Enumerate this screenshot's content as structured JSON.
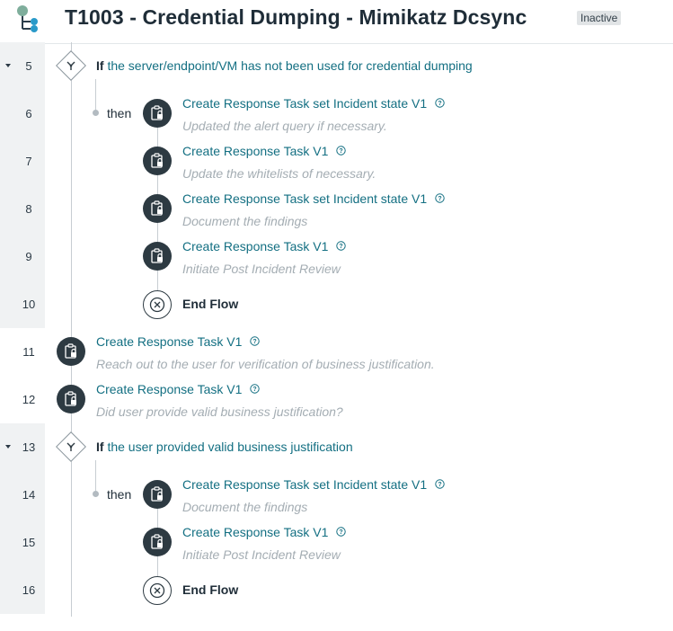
{
  "header": {
    "title": "T1003 - Credential Dumping - Mimikatz Dcsync",
    "status_badge": "Inactive"
  },
  "keywords": {
    "if": "If",
    "then": "then"
  },
  "rows": [
    {
      "line": "5",
      "condition": "the server/endpoint/VM has not been used for credential dumping"
    },
    {
      "line": "6",
      "task": "Create Response Task set Incident state V1",
      "description": "Updated the alert query if necessary."
    },
    {
      "line": "7",
      "task": "Create Response Task V1",
      "description": "Update the whitelists of necessary."
    },
    {
      "line": "8",
      "task": "Create Response Task set Incident state V1",
      "description": "Document the findings"
    },
    {
      "line": "9",
      "task": "Create Response Task V1",
      "description": "Initiate Post Incident Review"
    },
    {
      "line": "10",
      "end": "End Flow"
    },
    {
      "line": "11",
      "task": "Create Response Task V1",
      "description": "Reach out to the user for verification of business justification."
    },
    {
      "line": "12",
      "task": "Create Response Task V1",
      "description": "Did user provide valid business justification?"
    },
    {
      "line": "13",
      "condition": "the user provided valid business justification"
    },
    {
      "line": "14",
      "task": "Create Response Task set Incident state V1",
      "description": "Document the findings"
    },
    {
      "line": "15",
      "task": "Create Response Task V1",
      "description": "Initiate Post Incident Review"
    },
    {
      "line": "16",
      "end": "End Flow"
    }
  ],
  "icons": {
    "logo": "workflow-tree-icon",
    "task": "clipboard-lock-icon",
    "help": "question-circle-icon",
    "if": "branch-icon",
    "end": "close-circle-icon",
    "collapse": "caret-down-icon"
  }
}
